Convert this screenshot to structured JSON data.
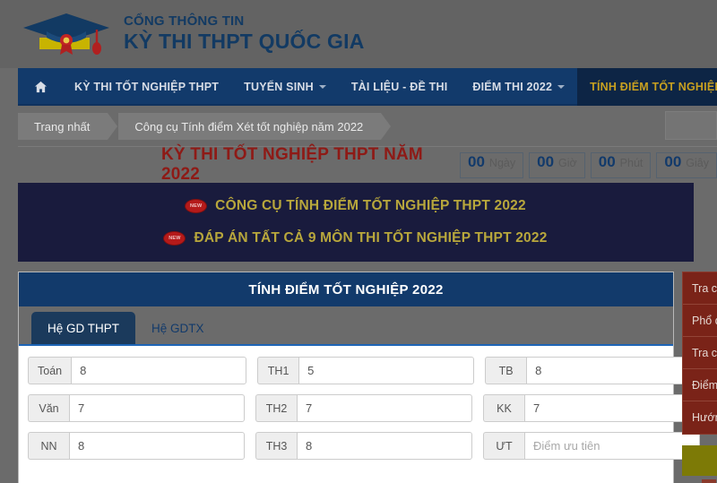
{
  "site": {
    "logo_line1": "CỔNG THÔNG TIN",
    "logo_line2": "KỲ THI THPT QUỐC GIA",
    "logo_icon": "graduation-cap-icon"
  },
  "nav": {
    "home_icon": "home-icon",
    "items": [
      {
        "label": "KỲ THI TỐT NGHIỆP THPT",
        "caret": false,
        "active": false
      },
      {
        "label": "TUYỂN SINH",
        "caret": true,
        "active": false
      },
      {
        "label": "TÀI LIỆU - ĐỀ THI",
        "caret": false,
        "active": false
      },
      {
        "label": "ĐIỂM THI 2022",
        "caret": true,
        "active": false
      },
      {
        "label": "TÍNH ĐIỂM TỐT NGHIỆP",
        "caret": false,
        "active": true
      }
    ]
  },
  "breadcrumb": {
    "items": [
      "Trang nhất",
      "Công cụ Tính điểm Xét tốt nghiệp năm 2022"
    ]
  },
  "exam": {
    "title": "KỲ THI TỐT NGHIỆP THPT NĂM 2022",
    "countdown": [
      {
        "value": "00",
        "unit": "Ngày"
      },
      {
        "value": "00",
        "unit": "Giờ"
      },
      {
        "value": "00",
        "unit": "Phút"
      },
      {
        "value": "00",
        "unit": "Giây"
      }
    ]
  },
  "banner": {
    "badge_text": "NEW",
    "links": [
      "CÔNG CỤ TÍNH ĐIỂM TỐT NGHIỆP THPT 2022",
      "ĐÁP ÁN TẤT CẢ 9 MÔN THI TỐT NGHIỆP THPT 2022"
    ]
  },
  "calculator": {
    "header": "TÍNH ĐIỂM TỐT NGHIỆP 2022",
    "tabs": [
      {
        "label": "Hệ GD THPT",
        "active": true
      },
      {
        "label": "Hệ GDTX",
        "active": false
      }
    ],
    "rows": [
      [
        {
          "label": "Toán",
          "value": "8",
          "placeholder": ""
        },
        {
          "label": "TH1",
          "value": "5",
          "placeholder": ""
        },
        {
          "label": "TB",
          "value": "8",
          "placeholder": ""
        }
      ],
      [
        {
          "label": "Văn",
          "value": "7",
          "placeholder": ""
        },
        {
          "label": "TH2",
          "value": "7",
          "placeholder": ""
        },
        {
          "label": "KK",
          "value": "7",
          "placeholder": ""
        }
      ],
      [
        {
          "label": "NN",
          "value": "8",
          "placeholder": ""
        },
        {
          "label": "TH3",
          "value": "8",
          "placeholder": ""
        },
        {
          "label": "ƯT",
          "value": "",
          "placeholder": "Điểm ưu tiên"
        }
      ]
    ]
  },
  "sidebar": {
    "items": [
      "Tra cứu",
      "Phổ điểm",
      "Tra cứu",
      "Điểm",
      "Hướng"
    ]
  },
  "colors": {
    "nav_blue": "#123a6b",
    "nav_active_gold": "#c8a020",
    "banner_navy": "#191b3d",
    "banner_gold": "#b8a73c",
    "exam_title_red": "#8e1a16",
    "sidebar_red": "#7a2318",
    "page_gray": "#6b6b6b"
  }
}
